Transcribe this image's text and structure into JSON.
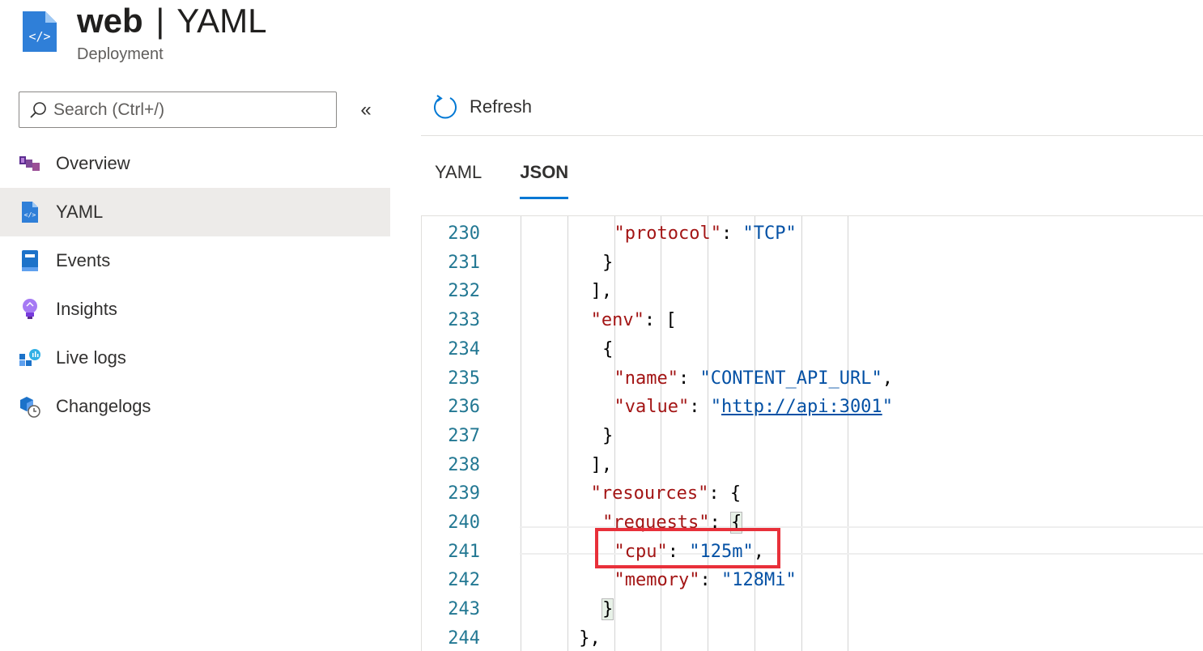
{
  "header": {
    "name": "web",
    "separator": "|",
    "title": "YAML",
    "subtitle": "Deployment"
  },
  "search": {
    "placeholder": "Search (Ctrl+/)"
  },
  "sidebar": {
    "collapse_label": "«",
    "items": [
      {
        "label": "Overview",
        "icon": "cubes-icon"
      },
      {
        "label": "YAML",
        "icon": "yaml-file-icon"
      },
      {
        "label": "Events",
        "icon": "events-icon"
      },
      {
        "label": "Insights",
        "icon": "lightbulb-icon"
      },
      {
        "label": "Live logs",
        "icon": "live-logs-icon"
      },
      {
        "label": "Changelogs",
        "icon": "changelogs-icon"
      }
    ],
    "active_index": 1
  },
  "toolbar": {
    "refresh_label": "Refresh"
  },
  "tabs": [
    {
      "label": "YAML",
      "active": false
    },
    {
      "label": "JSON",
      "active": true
    }
  ],
  "editor": {
    "lines": [
      {
        "no": "230",
        "tokens": [
          [
            "key",
            "\"protocol\""
          ],
          [
            "p",
            ": "
          ],
          [
            "str",
            "\"TCP\""
          ]
        ]
      },
      {
        "no": "231",
        "tokens": [
          [
            "p",
            "}"
          ]
        ]
      },
      {
        "no": "232",
        "tokens": [
          [
            "p",
            "],"
          ]
        ]
      },
      {
        "no": "233",
        "tokens": [
          [
            "key",
            "\"env\""
          ],
          [
            "p",
            ": ["
          ]
        ]
      },
      {
        "no": "234",
        "tokens": [
          [
            "p",
            "{"
          ]
        ]
      },
      {
        "no": "235",
        "tokens": [
          [
            "key",
            "\"name\""
          ],
          [
            "p",
            ": "
          ],
          [
            "str",
            "\"CONTENT_API_URL\""
          ],
          [
            "p",
            ","
          ]
        ]
      },
      {
        "no": "236",
        "tokens": [
          [
            "key",
            "\"value\""
          ],
          [
            "p",
            ": "
          ],
          [
            "str",
            "\""
          ],
          [
            "link",
            "http://api:3001"
          ],
          [
            "str",
            "\""
          ]
        ]
      },
      {
        "no": "237",
        "tokens": [
          [
            "p",
            "}"
          ]
        ]
      },
      {
        "no": "238",
        "tokens": [
          [
            "p",
            "],"
          ]
        ]
      },
      {
        "no": "239",
        "tokens": [
          [
            "key",
            "\"resources\""
          ],
          [
            "p",
            ": {"
          ]
        ]
      },
      {
        "no": "240",
        "tokens": [
          [
            "key",
            "\"requests\""
          ],
          [
            "p",
            ": "
          ],
          [
            "bracket",
            "{"
          ]
        ]
      },
      {
        "no": "241",
        "tokens": [
          [
            "key",
            "\"cpu\""
          ],
          [
            "p",
            ": "
          ],
          [
            "str",
            "\"125m\""
          ],
          [
            "p",
            ","
          ]
        ]
      },
      {
        "no": "242",
        "tokens": [
          [
            "key",
            "\"memory\""
          ],
          [
            "p",
            ": "
          ],
          [
            "str",
            "\"128Mi\""
          ]
        ]
      },
      {
        "no": "243",
        "tokens": [
          [
            "bracket",
            "}"
          ]
        ]
      },
      {
        "no": "244",
        "tokens": [
          [
            "p",
            "},"
          ]
        ]
      }
    ]
  },
  "colors": {
    "accent": "#0078d4",
    "highlight_box": "#e8303a",
    "json_key": "#a31515",
    "json_string": "#0451a5",
    "line_number": "#237893"
  }
}
